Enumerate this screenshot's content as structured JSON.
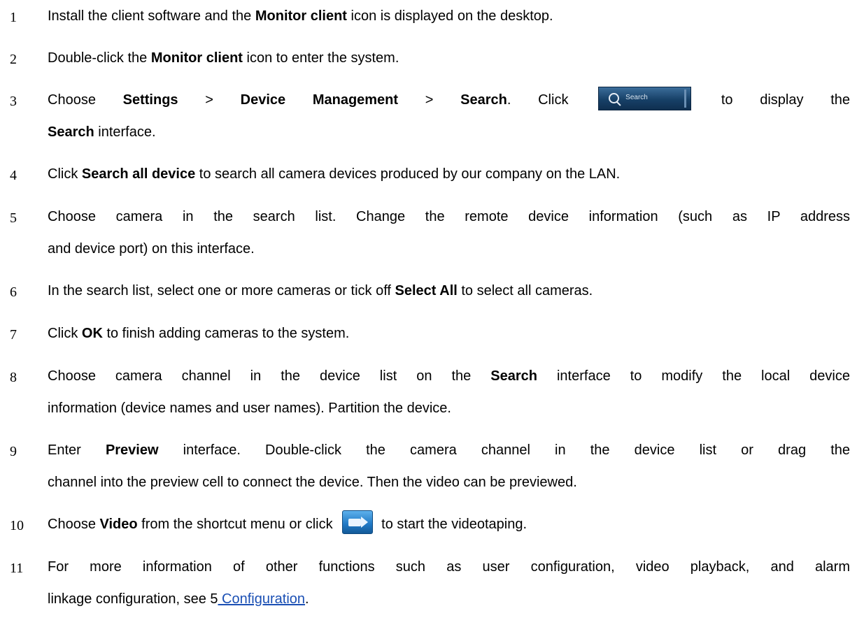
{
  "steps": [
    {
      "num": "1",
      "lines": [
        [
          {
            "t": "Install the client software and the "
          },
          {
            "b": "Monitor client"
          },
          {
            "t": " icon is displayed on the desktop."
          }
        ]
      ]
    },
    {
      "num": "2",
      "lines": [
        [
          {
            "t": "Double-click the "
          },
          {
            "b": "Monitor client"
          },
          {
            "t": " icon to enter the system."
          }
        ]
      ]
    },
    {
      "num": "3",
      "line1_a": "Choose ",
      "line1_b1": "Settings",
      "line1_sep1": " > ",
      "line1_b2": "Device Management",
      "line1_sep2": " > ",
      "line1_b3": "Search",
      "line1_c": ". Click ",
      "button_label": "Search",
      "line1_d": " to display the",
      "line2_b": "Search",
      "line2_t": " interface."
    },
    {
      "num": "4",
      "a": "Click ",
      "b": "Search all device",
      "c": " to search all camera devices produced by our company on the LAN."
    },
    {
      "num": "5",
      "line1": "Choose camera in the search list. Change the remote device information (such as IP address",
      "line2": "and device port) on this interface."
    },
    {
      "num": "6",
      "a": "In the search list, select one or more cameras or tick off ",
      "b": "Select All",
      "c": " to select all cameras."
    },
    {
      "num": "7",
      "a": "Click ",
      "b": "OK",
      "c": " to finish adding cameras to the system."
    },
    {
      "num": "8",
      "line1_a": "Choose camera channel in the device list on the ",
      "line1_b": "Search",
      "line1_c": " interface to modify the local device",
      "line2": "information (device names and user names). Partition the device."
    },
    {
      "num": "9",
      "line1_a": "Enter ",
      "line1_b": "Preview",
      "line1_c": " interface. Double-click the camera channel in the device list or drag the",
      "line2": "channel into the preview cell to connect the device. Then the video can be previewed."
    },
    {
      "num": "10",
      "a": "Choose ",
      "b": "Video",
      "c": " from the shortcut menu or click ",
      "d": "to start the videotaping."
    },
    {
      "num": "11",
      "line1": "For more information of other functions such as user configuration, video playback, and alarm",
      "line2_a": "linkage configuration, see 5",
      "line2_link": " Configuration",
      "line2_b": "."
    }
  ],
  "colors": {
    "text": "#000000",
    "link": "#1a4fb4",
    "search_button": "#174067",
    "video_button": "#1f78c4"
  },
  "icons": {
    "search_button_icon": "magnifier-icon",
    "video_button_icon": "video-record-icon"
  }
}
